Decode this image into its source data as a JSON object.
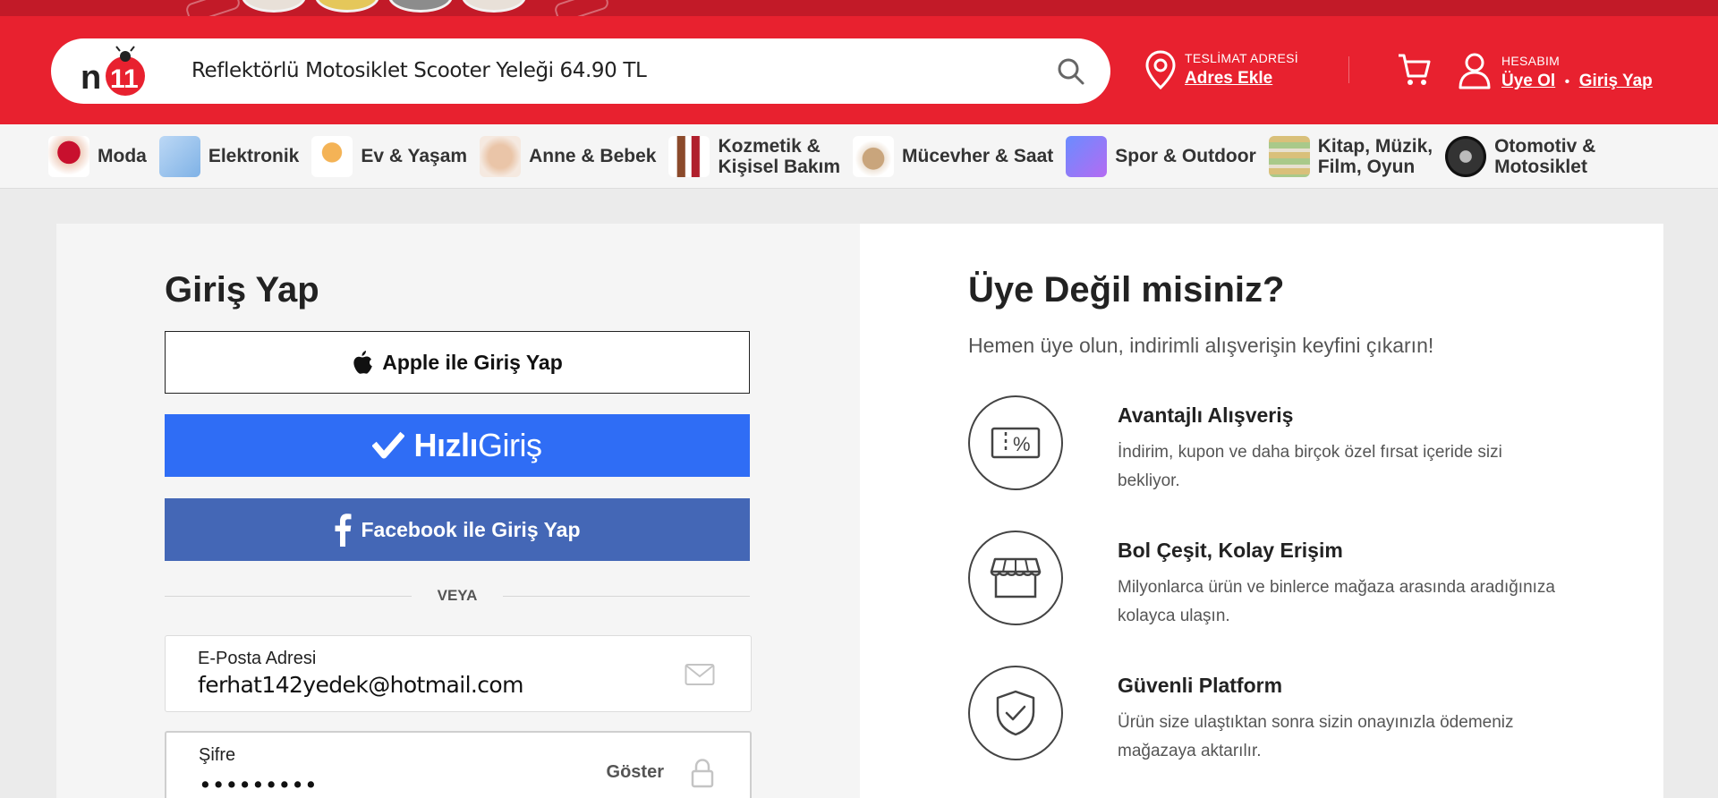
{
  "header": {
    "search_value": "Reflektörlü Motosiklet Scooter Yeleği 64.90 TL",
    "delivery_caption": "TESLİMAT ADRESİ",
    "delivery_link": "Adres Ekle",
    "account_caption": "HESABIM",
    "register_link": "Üye Ol",
    "login_link": "Giriş Yap",
    "separator": "•"
  },
  "categories": [
    {
      "label": "Moda"
    },
    {
      "label": "Elektronik"
    },
    {
      "label": "Ev & Yaşam"
    },
    {
      "label": "Anne & Bebek"
    },
    {
      "label": "Kozmetik &\nKişisel Bakım"
    },
    {
      "label": "Mücevher & Saat"
    },
    {
      "label": "Spor & Outdoor"
    },
    {
      "label": "Kitap, Müzik,\nFilm, Oyun"
    },
    {
      "label": "Otomotiv &\nMotosiklet"
    }
  ],
  "login": {
    "title": "Giriş Yap",
    "apple_label": "Apple ile Giriş Yap",
    "hizli_bold": "Hızlı",
    "hizli_light": "Giriş",
    "facebook_label": "Facebook ile Giriş Yap",
    "divider_label": "VEYA",
    "email_label": "E-Posta Adresi",
    "email_value": "ferhat142yedek@hotmail.com",
    "password_label": "Şifre",
    "password_value": "•••••••••",
    "show_label": "Göster"
  },
  "signup": {
    "title": "Üye Değil misiniz?",
    "subtitle": "Hemen üye olun, indirimli alışverişin keyfini çıkarın!",
    "features": [
      {
        "icon": "discount-ticket-icon",
        "title": "Avantajlı Alışveriş",
        "desc": "İndirim, kupon ve daha birçok özel fırsat içeride sizi bekliyor."
      },
      {
        "icon": "store-icon",
        "title": "Bol Çeşit, Kolay Erişim",
        "desc": "Milyonlarca ürün ve binlerce mağaza arasında aradığınıza kolayca ulaşın."
      },
      {
        "icon": "shield-check-icon",
        "title": "Güvenli Platform",
        "desc": "Ürün size ulaştıktan sonra sizin onayınızla ödemeniz mağazaya aktarılır."
      }
    ]
  },
  "colors": {
    "brand_red": "#e8212f",
    "hizli_blue": "#2f6df5",
    "facebook_blue": "#4467b6"
  }
}
